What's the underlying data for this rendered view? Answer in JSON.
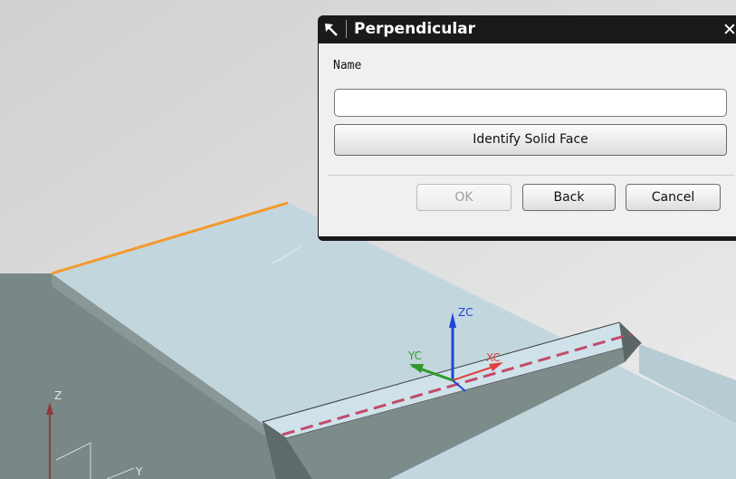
{
  "dialog": {
    "title": "Perpendicular",
    "close_symbol": "✕",
    "name_label": "Name",
    "name_value": "",
    "identify_button": "Identify Solid Face",
    "ok_button": "OK",
    "back_button": "Back",
    "cancel_button": "Cancel"
  },
  "viewport": {
    "axis_labels": {
      "zc": "ZC",
      "yc": "YC",
      "xc": "XC",
      "abs_z": "Z",
      "abs_y": "Y"
    }
  },
  "icons": {
    "title": "pin-icon",
    "close": "close-icon"
  },
  "colors": {
    "highlight_edge": "#f39a2b",
    "zc_axis": "#1f45d8",
    "yc_axis": "#2f9a2a",
    "xc_axis": "#e04040",
    "centerline": "#c24a6b"
  }
}
